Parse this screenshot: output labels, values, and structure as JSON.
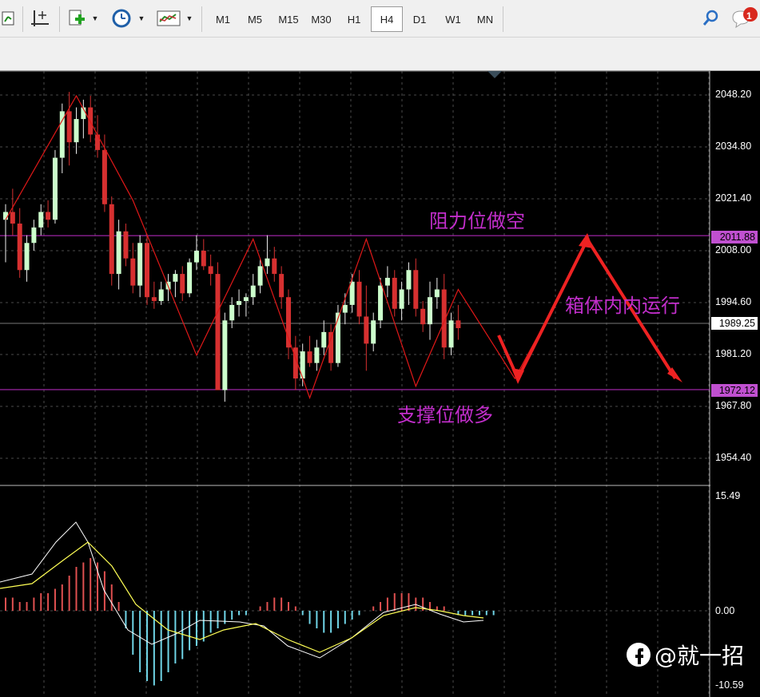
{
  "toolbar": {
    "timeframes": [
      "M1",
      "M5",
      "M15",
      "M30",
      "H1",
      "H4",
      "D1",
      "W1",
      "MN"
    ],
    "active_timeframe": "H4",
    "notification_count": "1"
  },
  "price_axis": {
    "ticks": [
      "2048.20",
      "2034.80",
      "2021.40",
      "2008.00",
      "1994.60",
      "1981.20",
      "1967.80",
      "1954.40"
    ],
    "current_price": "1989.25",
    "resistance_label": "2011.88",
    "support_label": "1972.12"
  },
  "indicator_axis": {
    "ticks": [
      "15.49",
      "0.00",
      "-10.59"
    ]
  },
  "annotations": {
    "resistance": "阻力位做空",
    "support": "支撑位做多",
    "range": "箱体内内运行"
  },
  "watermark": "@就一招",
  "colors": {
    "bull_candle": "#ccffcc",
    "bear_candle": "#d63030",
    "zigzag": "#e01818",
    "level_line": "#c22ecb",
    "hist_pos": "#e05050",
    "hist_neg": "#6fd4e6",
    "macd_line": "#ffffff",
    "signal_line": "#ffff55",
    "arrow": "#ee2222"
  }
}
